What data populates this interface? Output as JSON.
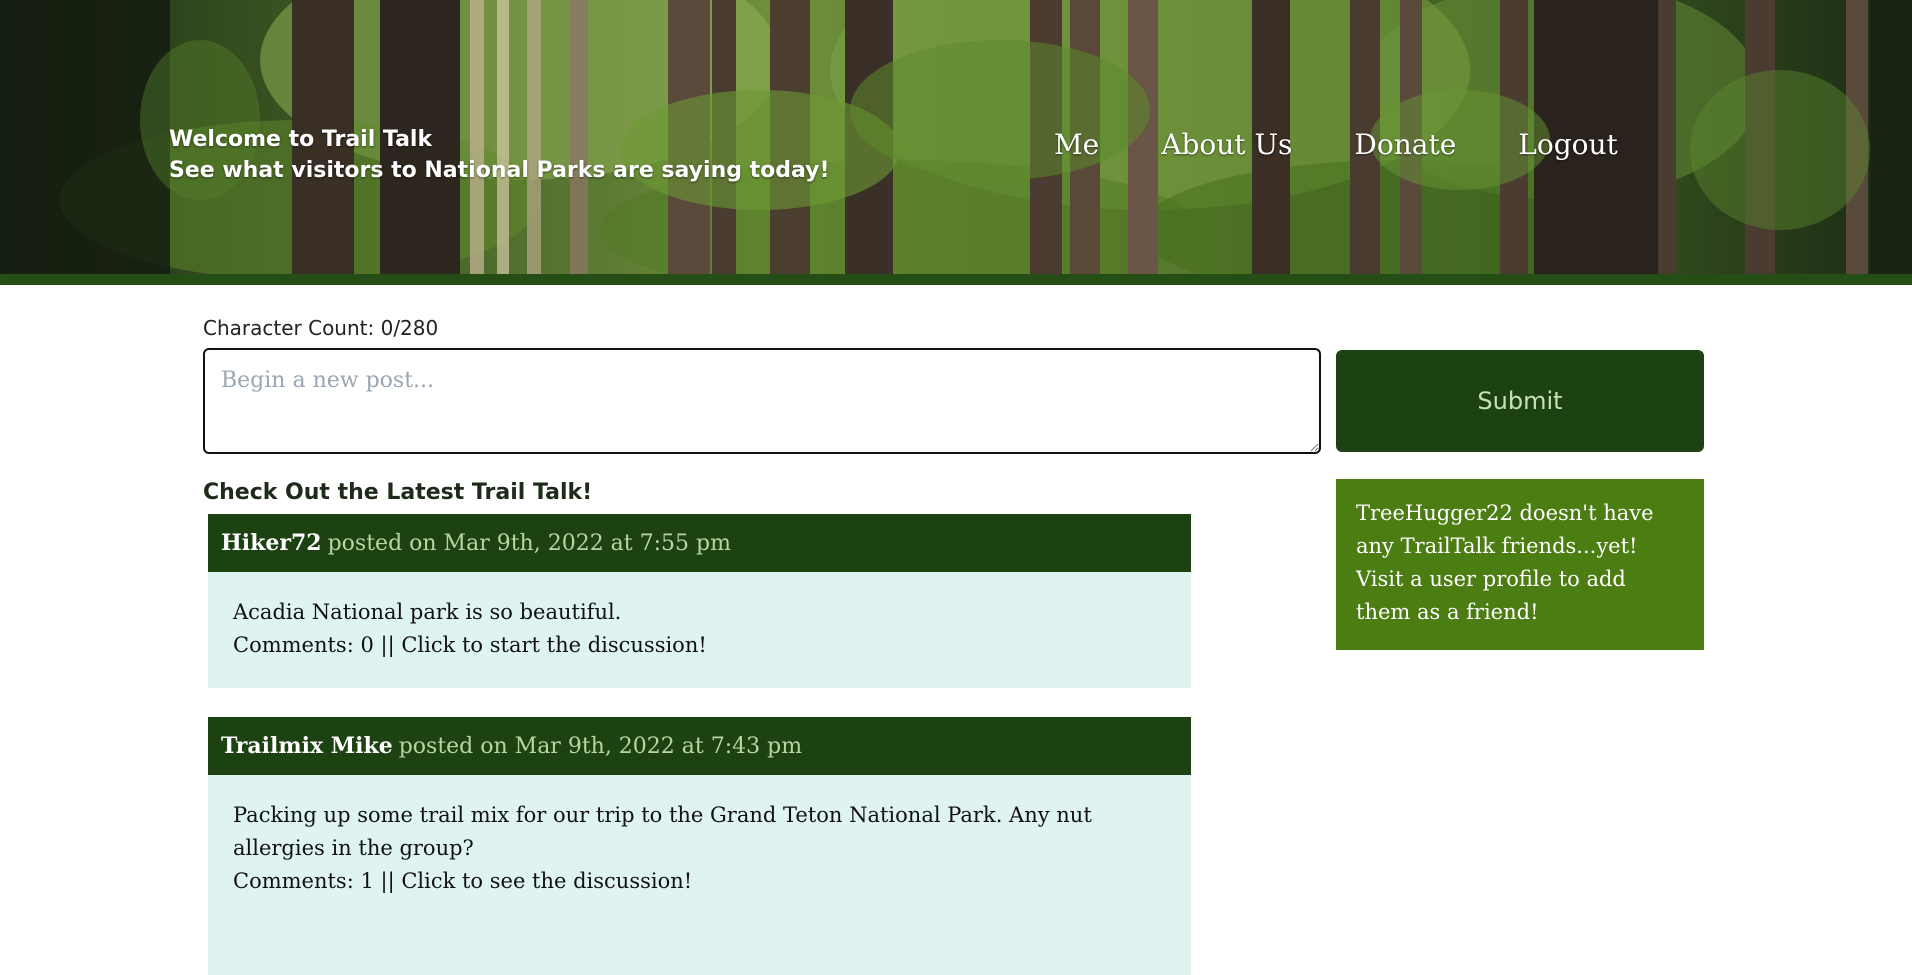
{
  "header": {
    "welcome_line": "Welcome to Trail Talk",
    "tagline": "See what visitors to National Parks are saying today!",
    "nav": [
      {
        "label": "Me"
      },
      {
        "label": "About Us"
      },
      {
        "label": "Donate"
      },
      {
        "label": "Logout"
      }
    ]
  },
  "composer": {
    "char_count_label": "Character Count: 0/280",
    "placeholder": "Begin a new post...",
    "submit_label": "Submit"
  },
  "friends_panel": {
    "message": "TreeHugger22 doesn't have any TrailTalk friends...yet! Visit a user profile to add them as a friend!"
  },
  "feed": {
    "title": "Check Out the Latest Trail Talk!",
    "posts": [
      {
        "author": "Hiker72",
        "posted_on": "posted on Mar 9th, 2022 at 7:55 pm",
        "text": "Acadia National park is so beautiful.",
        "comments": "Comments: 0 || Click to start the discussion!"
      },
      {
        "author": "Trailmix Mike",
        "posted_on": "posted on Mar 9th, 2022 at 7:43 pm",
        "text": "Packing up some trail mix for our trip to the Grand Teton National Park. Any nut allergies in the group?",
        "comments": "Comments: 1 || Click to see the discussion!"
      }
    ]
  },
  "colors": {
    "dark_green": "#1c4212",
    "accent_green": "#4b7d12",
    "post_body_bg": "#dff3f1",
    "header_strip": "#254e17"
  }
}
